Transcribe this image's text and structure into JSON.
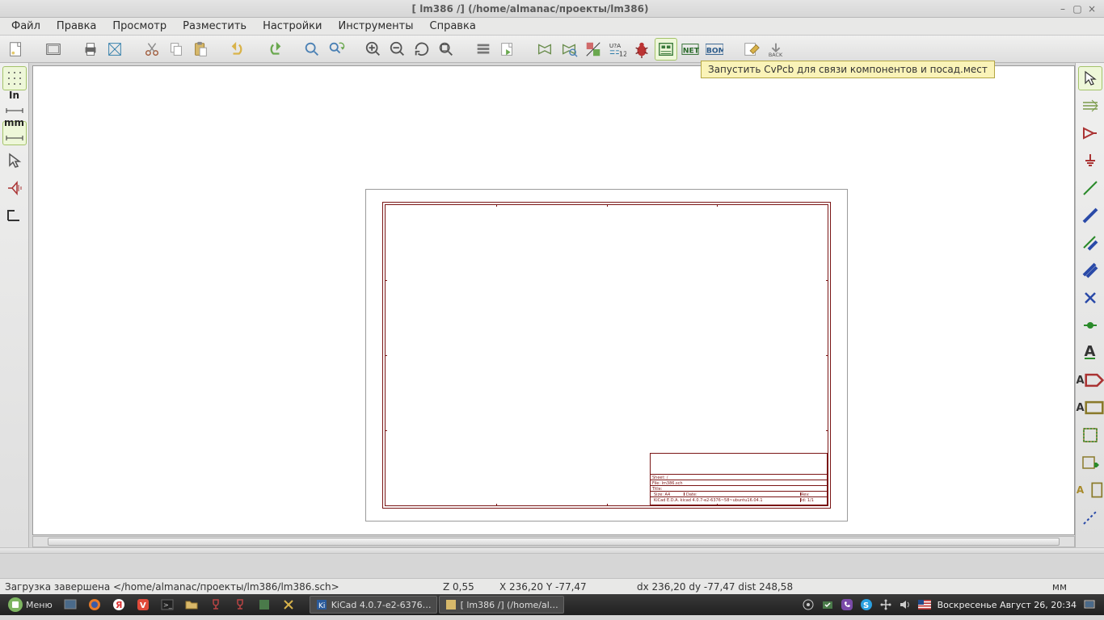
{
  "window": {
    "title": "[ lm386 /] (/home/almanac/проекты/lm386)"
  },
  "menu": {
    "file": "Файл",
    "edit": "Правка",
    "view": "Просмотр",
    "place": "Разместить",
    "prefs": "Настройки",
    "tools": "Инструменты",
    "help": "Справка"
  },
  "tooltip": {
    "cvpcb": "Запустить CvPcb для связи компонентов и посад.мест"
  },
  "left": {
    "inch": "In",
    "mm": "mm"
  },
  "right": {
    "text_A": "A",
    "add_glabel": "A",
    "add_hlabel": "A",
    "del_A": "A"
  },
  "status": {
    "message": "Загрузка завершена </home/almanac/проекты/lm386/lm386.sch>",
    "zoom": "Z 0,55",
    "xy": "X 236,20  Y -77,47",
    "dxy": "dx 236,20  dy -77,47  dist 248,58",
    "units": "мм"
  },
  "taskbar": {
    "menu": "Меню",
    "app1": "KiCad 4.0.7-e2-6376…",
    "app2": "[ lm386 /] (/home/al…",
    "clock": "Воскресенье Август 26, 20:34"
  },
  "titleblock": {
    "line1": "Sheet: /",
    "line2": "File: lm386.sch",
    "line3": "Title:",
    "size": "Size: A4",
    "date": "Date:",
    "rev": "Rev:",
    "kicad": "KiCad E.D.A.  kicad 4.0.7-e2-6376~58~ubuntu16.04.1",
    "id": "Id: 1/1"
  }
}
